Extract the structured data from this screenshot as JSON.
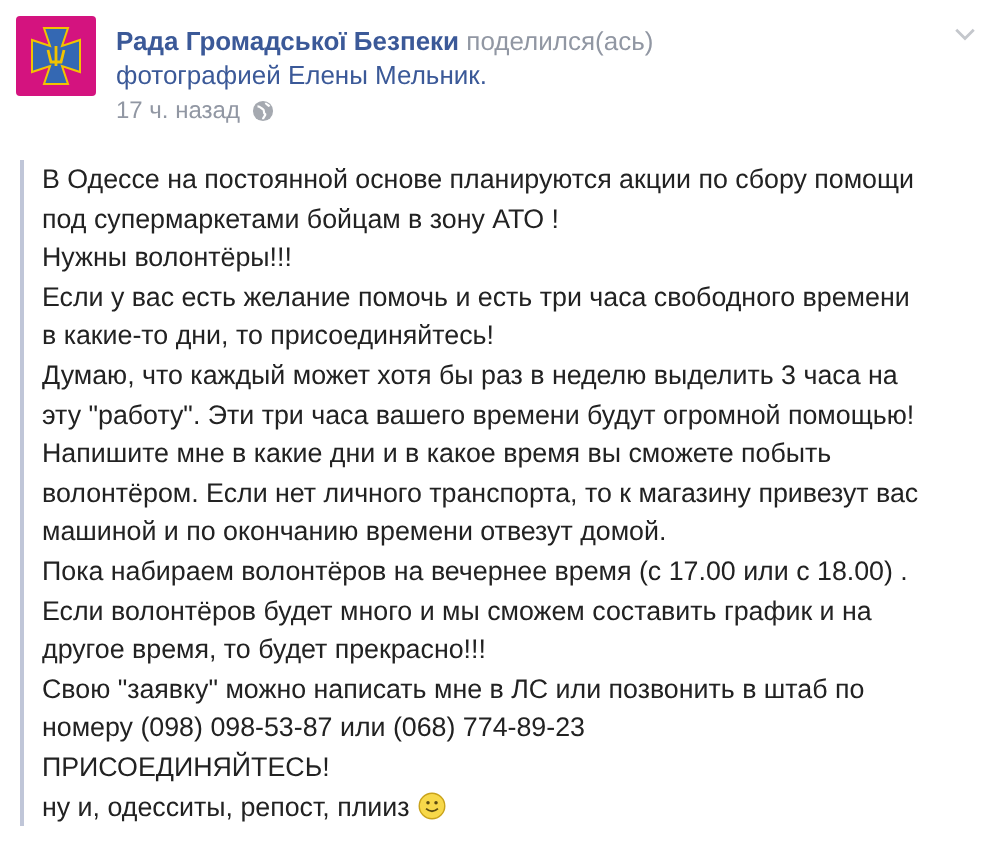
{
  "post": {
    "author": "Рада Громадської Безпеки",
    "action": "поделился(ась)",
    "shared_object": "фотографией Елены Мельник.",
    "time": "17 ч. назад",
    "lines": [
      {
        "text": "В Одессе на постоянной основе планируются акции по сбору помощи"
      },
      {
        "text": "под супермаркетами бойцам в зону АТО !"
      },
      {
        "text": "Нужны волонтёры!!!"
      },
      {
        "text": "Если у вас есть желание помочь и есть три часа свободного времени"
      },
      {
        "text": "в какие-то дни, то присоединяйтесь!"
      },
      {
        "text": "Думаю, что каждый может хотя бы раз в неделю выделить 3 часа на"
      },
      {
        "text": "эту \"работу\". Эти три часа вашего времени будут огромной помощью!"
      },
      {
        "text": "Напишите мне в какие дни и в какое время вы сможете побыть"
      },
      {
        "text": "волонтёром. Если нет личного транспорта, то к магазину привезут вас"
      },
      {
        "text": "машиной и по окончанию времени отвезут домой."
      },
      {
        "text": "Пока набираем волонтёров на вечернее время (с 17.00 или с 18.00) ."
      },
      {
        "text": "Если волонтёров будет много и мы сможем составить график и на"
      },
      {
        "text": "другое время, то будет прекрасно!!!"
      },
      {
        "text": "Свою \"заявку\" можно написать мне в ЛС или позвонить в штаб по"
      },
      {
        "text": "номеру (098) 098-53-87 или (068) 774-89-23"
      },
      {
        "text": "ПРИСОЕДИНЯЙТЕСЬ!"
      },
      {
        "text": "ну и, одесситы, репост, плииз",
        "emoji": true
      }
    ]
  }
}
